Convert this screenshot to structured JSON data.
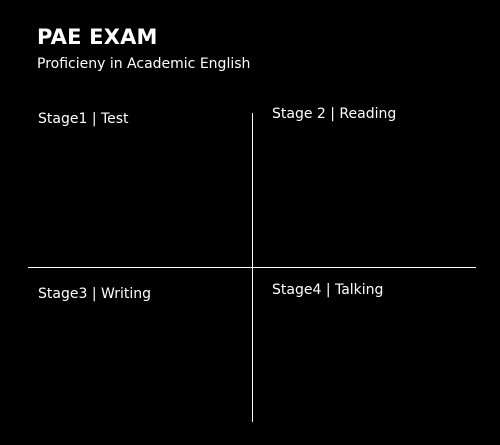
{
  "header": {
    "title": "PAE EXAM",
    "subtitle": "Proficieny in Academic English"
  },
  "stages": [
    {
      "label": "Stage1 | Test"
    },
    {
      "label": "Stage 2 | Reading"
    },
    {
      "label": "Stage3 | Writing"
    },
    {
      "label": "Stage4 | Talking"
    }
  ],
  "colors": {
    "background": "#000000",
    "foreground": "#ffffff"
  }
}
